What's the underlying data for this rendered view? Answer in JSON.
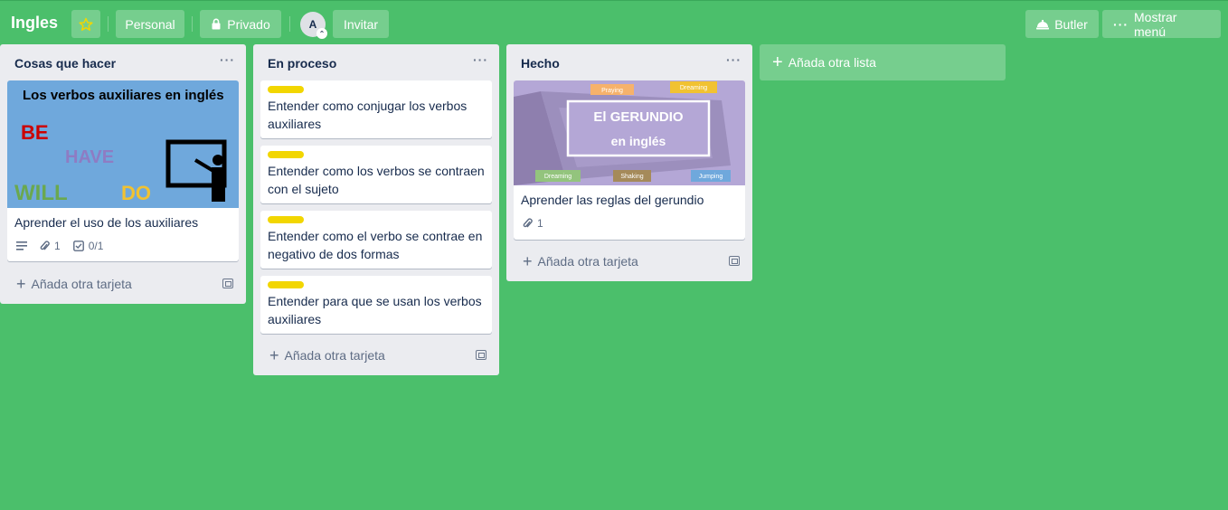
{
  "header": {
    "board_title": "Ingles",
    "star_icon": "star-icon",
    "visibility_team": "Personal",
    "privacy": "Privado",
    "avatar_initial": "A",
    "invite": "Invitar",
    "butler": "Butler",
    "show_menu": "Mostrar menú"
  },
  "colors": {
    "board_bg": "#4bbf6b",
    "list_bg": "#ebecf0",
    "label_yellow": "#f2d600",
    "star": "#f2d600"
  },
  "lists": [
    {
      "title": "Cosas que hacer",
      "cards": [
        {
          "cover": {
            "heading": "Los verbos auxiliares en inglés",
            "words": [
              "BE",
              "HAVE",
              "WILL",
              "DO"
            ]
          },
          "title": "Aprender el uso de los auxiliares",
          "attachments": "1",
          "checklist": "0/1"
        }
      ],
      "add_card": "Añada otra tarjeta"
    },
    {
      "title": "En proceso",
      "cards": [
        {
          "title": "Entender como conjugar los verbos auxiliares"
        },
        {
          "title": "Entender como los verbos se contraen con el sujeto"
        },
        {
          "title": "Entender como el verbo se contrae en negativo de dos formas"
        },
        {
          "title": "Entender para que se usan los verbos auxiliares"
        }
      ],
      "add_card": "Añada otra tarjeta"
    },
    {
      "title": "Hecho",
      "cards": [
        {
          "cover": {
            "line1": "El GERUNDIO",
            "line2": "en inglés",
            "tags": [
              "Praying",
              "Dreaming",
              "Dreaming",
              "Shaking",
              "Jumping"
            ]
          },
          "title": "Aprender las reglas del gerundio",
          "attachments": "1"
        }
      ],
      "add_card": "Añada otra tarjeta"
    }
  ],
  "add_list": "Añada otra lista"
}
